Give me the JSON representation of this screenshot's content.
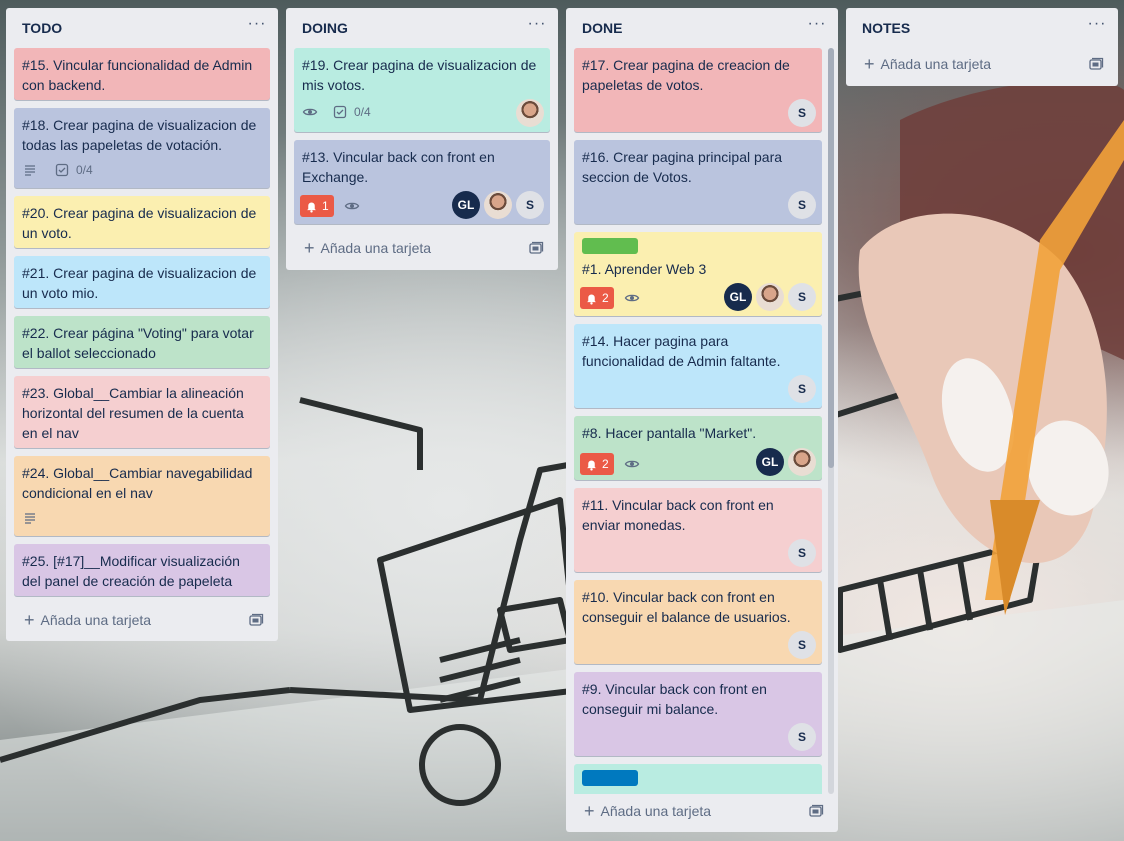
{
  "colors": {
    "red": "#f2b6b8",
    "blue_gray": "#bac4de",
    "yellow": "#fbefb0",
    "light_blue": "#bde6fa",
    "green": "#bde3c9",
    "pink": "#f5cfd0",
    "orange": "#f8d8b1",
    "purple": "#d9c6e5",
    "teal": "#b9ece1",
    "label_green": "#61bd4f",
    "label_blue": "#0079bf",
    "bell": "#eb5a46"
  },
  "add_card_label": "Añada una tarjeta",
  "lists": {
    "todo": {
      "title": "TODO",
      "cards": [
        {
          "title": "#15. Vincular funcionalidad de Admin con backend."
        },
        {
          "title": "#18. Crear pagina de visualizacion de todas las papeletas de votación.",
          "checklist": "0/4"
        },
        {
          "title": "#20. Crear pagina de visualizacion de un voto."
        },
        {
          "title": "#21. Crear pagina de visualizacion de un voto mio."
        },
        {
          "title": "#22. Crear página \"Voting\" para votar el ballot seleccionado"
        },
        {
          "title": "#23. Global__Cambiar la alineación horizontal del resumen de la cuenta en el nav"
        },
        {
          "title": "#24. Global__Cambiar navegabilidad condicional en el nav"
        },
        {
          "title": "#25. [#17]__Modificar visualización del panel de creación de papeleta"
        }
      ]
    },
    "doing": {
      "title": "DOING",
      "cards": [
        {
          "title": "#19. Crear pagina de visualizacion de mis votos.",
          "checklist": "0/4"
        },
        {
          "title": "#13. Vincular back con front en Exchange.",
          "notifications": "1",
          "members": [
            "GL",
            "S"
          ]
        }
      ]
    },
    "done": {
      "title": "DONE",
      "cards": [
        {
          "title": "#17. Crear pagina de creacion de papeletas de votos.",
          "members": [
            "S"
          ]
        },
        {
          "title": "#16. Crear pagina principal para seccion de Votos.",
          "members": [
            "S"
          ]
        },
        {
          "title": "#1. Aprender Web 3",
          "notifications": "2",
          "members": [
            "GL",
            "S"
          ]
        },
        {
          "title": "#14. Hacer pagina para funcionalidad de Admin faltante.",
          "members": [
            "S"
          ]
        },
        {
          "title": "#8. Hacer pantalla \"Market\".",
          "notifications": "2",
          "members": [
            "GL"
          ]
        },
        {
          "title": "#11. Vincular back con front en enviar monedas.",
          "members": [
            "S"
          ]
        },
        {
          "title": "#10. Vincular back con front en conseguir el balance de usuarios.",
          "members": [
            "S"
          ]
        },
        {
          "title": "#9. Vincular back con front en conseguir mi balance.",
          "members": [
            "S"
          ]
        }
      ]
    },
    "notes": {
      "title": "NOTES"
    }
  }
}
